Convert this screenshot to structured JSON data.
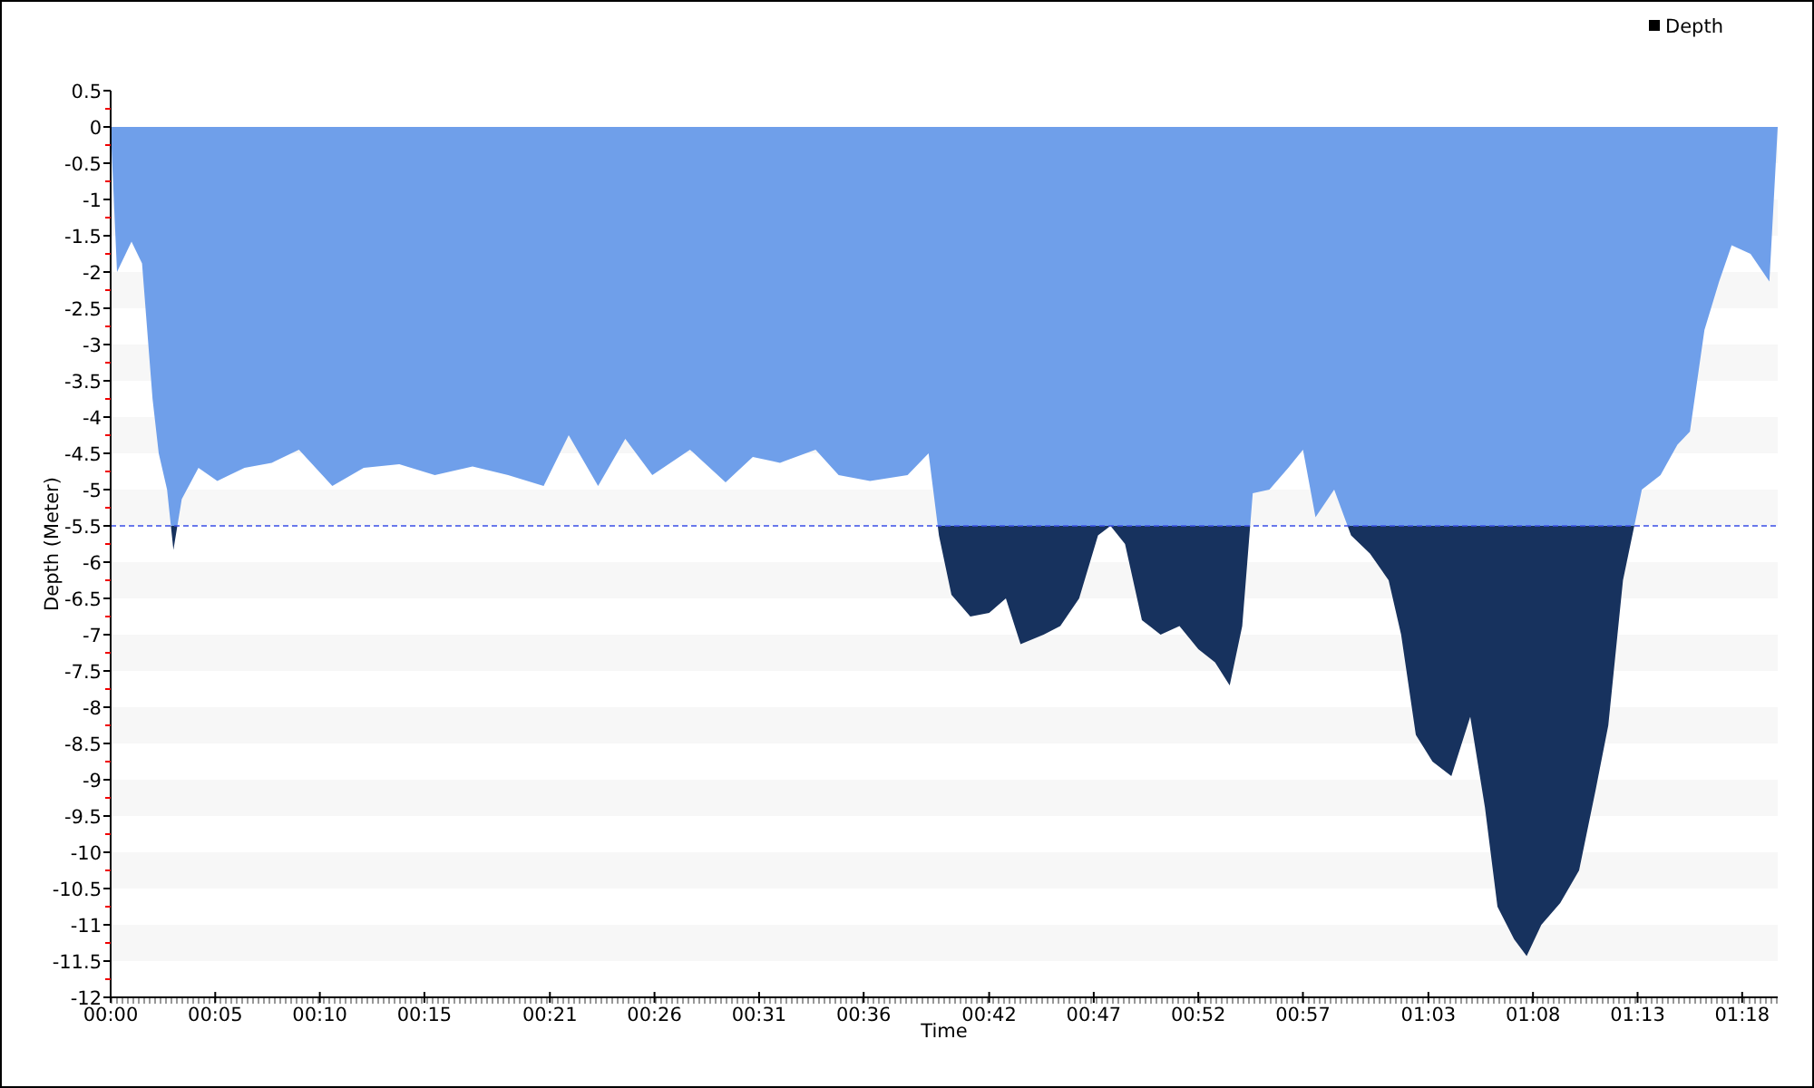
{
  "chart": {
    "chart_data": {
      "type": "area",
      "xlabel": "Time",
      "ylabel": "Depth (Meter)",
      "x": [
        0,
        0.3,
        1.0,
        1.5,
        2.0,
        2.3,
        2.7,
        3.0,
        3.4,
        4.2,
        5.1,
        6.4,
        7.7,
        9.0,
        10.6,
        12.1,
        13.8,
        15.5,
        17.3,
        19.0,
        20.7,
        21.9,
        23.3,
        24.6,
        25.9,
        27.7,
        29.4,
        30.7,
        32.0,
        33.7,
        34.8,
        36.3,
        38.1,
        39.1,
        39.6,
        40.2,
        41.1,
        42.0,
        42.8,
        43.5,
        44.6,
        45.4,
        46.3,
        47.2,
        47.8,
        48.5,
        49.3,
        50.2,
        51.1,
        52.0,
        52.8,
        53.5,
        54.1,
        54.6,
        55.4,
        56.3,
        57.0,
        57.6,
        58.5,
        59.3,
        60.2,
        61.1,
        61.7,
        62.4,
        63.2,
        64.1,
        65.0,
        65.7,
        66.3,
        67.1,
        67.7,
        68.4,
        69.3,
        70.2,
        71.0,
        71.6,
        72.3,
        73.2,
        74.1,
        74.9,
        75.5,
        76.2,
        76.9,
        77.5,
        78.4,
        79.3,
        79.7
      ],
      "series": [
        {
          "name": "Depth",
          "color": "#6f9fea",
          "values": [
            0,
            -2.0,
            -1.58,
            -1.88,
            -3.75,
            -4.5,
            -5.0,
            -5.83,
            -5.13,
            -4.7,
            -4.88,
            -4.7,
            -4.63,
            -4.45,
            -4.95,
            -4.7,
            -4.65,
            -4.8,
            -4.68,
            -4.8,
            -4.95,
            -4.25,
            -4.95,
            -4.3,
            -4.8,
            -4.45,
            -4.9,
            -4.55,
            -4.63,
            -4.45,
            -4.8,
            -4.88,
            -4.8,
            -4.5,
            -5.63,
            -6.45,
            -6.75,
            -6.7,
            -6.5,
            -7.13,
            -7.0,
            -6.88,
            -6.5,
            -5.63,
            -5.5,
            -5.75,
            -6.8,
            -7.0,
            -6.88,
            -7.2,
            -7.38,
            -7.7,
            -6.88,
            -5.05,
            -5.0,
            -4.7,
            -4.45,
            -5.38,
            -5.0,
            -5.63,
            -5.88,
            -6.25,
            -7.0,
            -8.38,
            -8.75,
            -8.95,
            -8.13,
            -9.38,
            -10.75,
            -11.2,
            -11.43,
            -11.0,
            -10.7,
            -10.25,
            -9.13,
            -8.25,
            -6.25,
            -5.0,
            -4.8,
            -4.38,
            -4.2,
            -2.8,
            -2.13,
            -1.63,
            -1.75,
            -2.13,
            0
          ]
        }
      ],
      "xlim": [
        0,
        79.7
      ],
      "ylim": [
        -12,
        0.5
      ],
      "xticks": [
        {
          "value": 0,
          "label": "00:00"
        },
        {
          "value": 5,
          "label": "00:05"
        },
        {
          "value": 10,
          "label": "00:10"
        },
        {
          "value": 15,
          "label": "00:15"
        },
        {
          "value": 21,
          "label": "00:21"
        },
        {
          "value": 26,
          "label": "00:26"
        },
        {
          "value": 31,
          "label": "00:31"
        },
        {
          "value": 36,
          "label": "00:36"
        },
        {
          "value": 42,
          "label": "00:42"
        },
        {
          "value": 47,
          "label": "00:47"
        },
        {
          "value": 52,
          "label": "00:52"
        },
        {
          "value": 57,
          "label": "00:57"
        },
        {
          "value": 63,
          "label": "01:03"
        },
        {
          "value": 68,
          "label": "01:08"
        },
        {
          "value": 73,
          "label": "01:13"
        },
        {
          "value": 78,
          "label": "01:18"
        }
      ],
      "yticks": [
        0.5,
        0,
        -0.5,
        -1,
        -1.5,
        -2,
        -2.5,
        -3,
        -3.5,
        -4,
        -4.5,
        -5,
        -5.5,
        -6,
        -6.5,
        -7,
        -7.5,
        -8,
        -8.5,
        -9,
        -9.5,
        -10,
        -10.5,
        -11,
        -11.5,
        -12
      ],
      "ref_lines": [
        {
          "axis": "y",
          "value": -5.5,
          "color": "#3a4de6"
        }
      ]
    }
  }
}
